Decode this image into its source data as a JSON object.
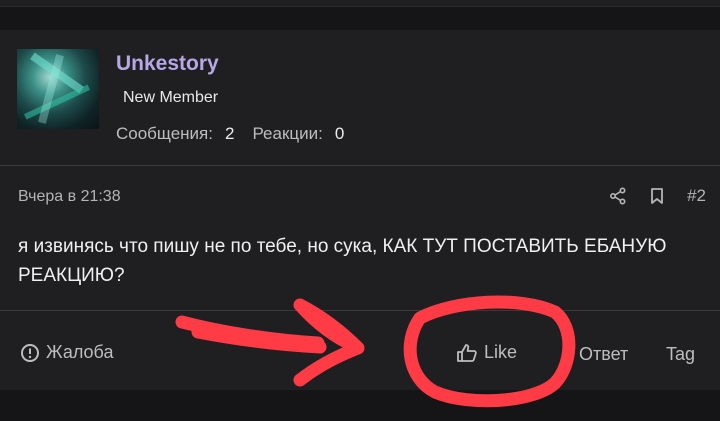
{
  "post": {
    "username": "Unkestory",
    "user_title": "New Member",
    "stats": {
      "messages_label": "Сообщения:",
      "messages_value": "2",
      "reactions_label": "Реакции:",
      "reactions_value": "0"
    },
    "timestamp": "Вчера в 21:38",
    "post_number": "#2",
    "message": "я извинясь что пишу не по тебе, но сука, КАК ТУТ ПОСТАВИТЬ ЕБАНУЮ РЕАКЦИЮ?"
  },
  "footer": {
    "report_label": "Жалоба",
    "like_label": "Like",
    "reply_label": "Ответ",
    "tag_label": "Tag"
  },
  "colors": {
    "background": "#151517",
    "card": "#1f1f21",
    "username": "#b7a7e6",
    "annotation": "#ff3b45"
  },
  "icons": [
    "share-icon",
    "bookmark-icon",
    "alert-circle-icon",
    "thumbs-up-icon"
  ]
}
